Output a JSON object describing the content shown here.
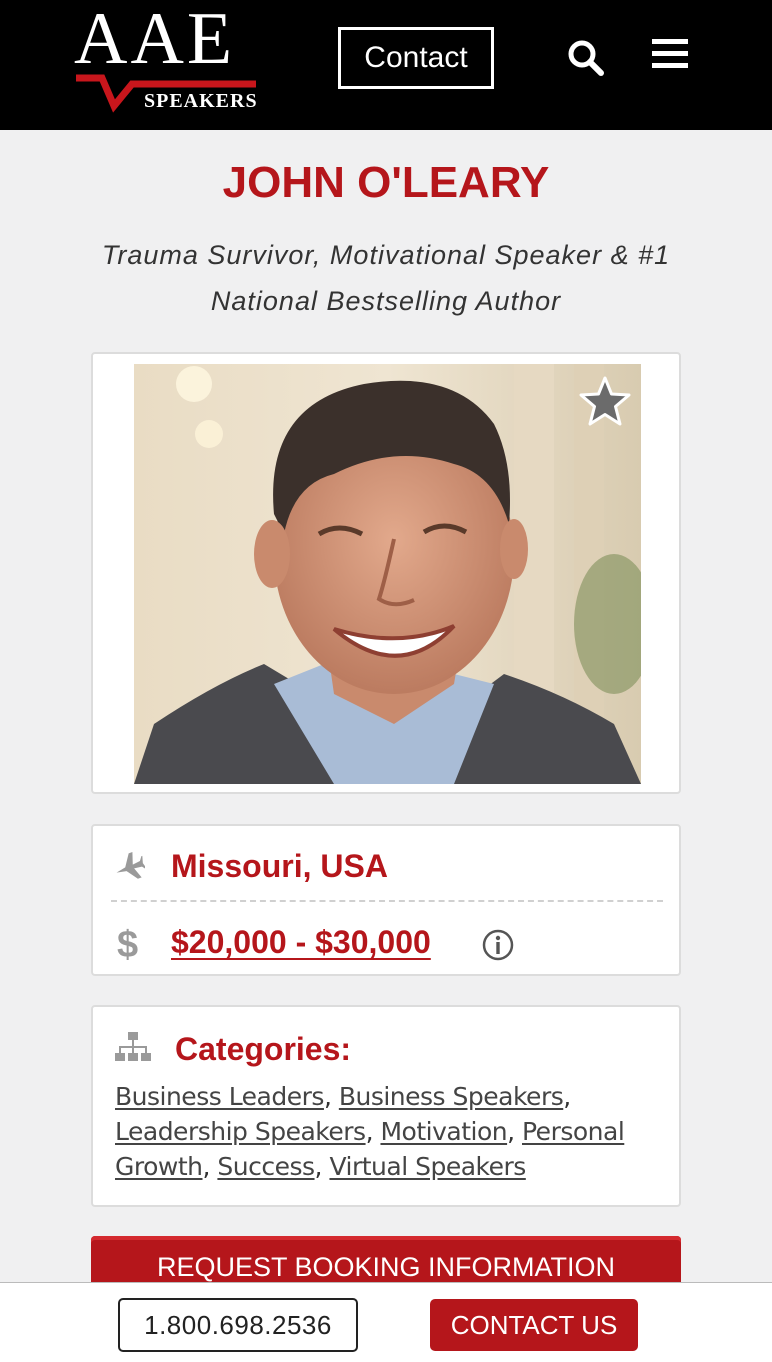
{
  "header": {
    "logo_main": "AAE",
    "logo_sub": "SPEAKERS",
    "contact_label": "Contact",
    "icons": [
      "search-icon",
      "menu-icon"
    ]
  },
  "speaker": {
    "name": "JOHN O'LEARY",
    "tagline": "Trauma Survivor, Motivational Speaker & #1 National Bestselling Author",
    "location": "Missouri, USA",
    "fee": "$20,000 - $30,000",
    "dollar_symbol": "$"
  },
  "categories": {
    "title": "Categories:",
    "items": [
      "Business Leaders",
      "Business Speakers",
      "Leadership Speakers",
      "Motivation",
      "Personal Growth",
      "Success",
      "Virtual Speakers"
    ]
  },
  "actions": {
    "request_label": "REQUEST BOOKING INFORMATION",
    "phone": "1.800.698.2536",
    "contact_us": "CONTACT US"
  },
  "colors": {
    "brand_red": "#b5161b",
    "header_bg": "#000000",
    "page_bg": "#f0f0f1"
  }
}
